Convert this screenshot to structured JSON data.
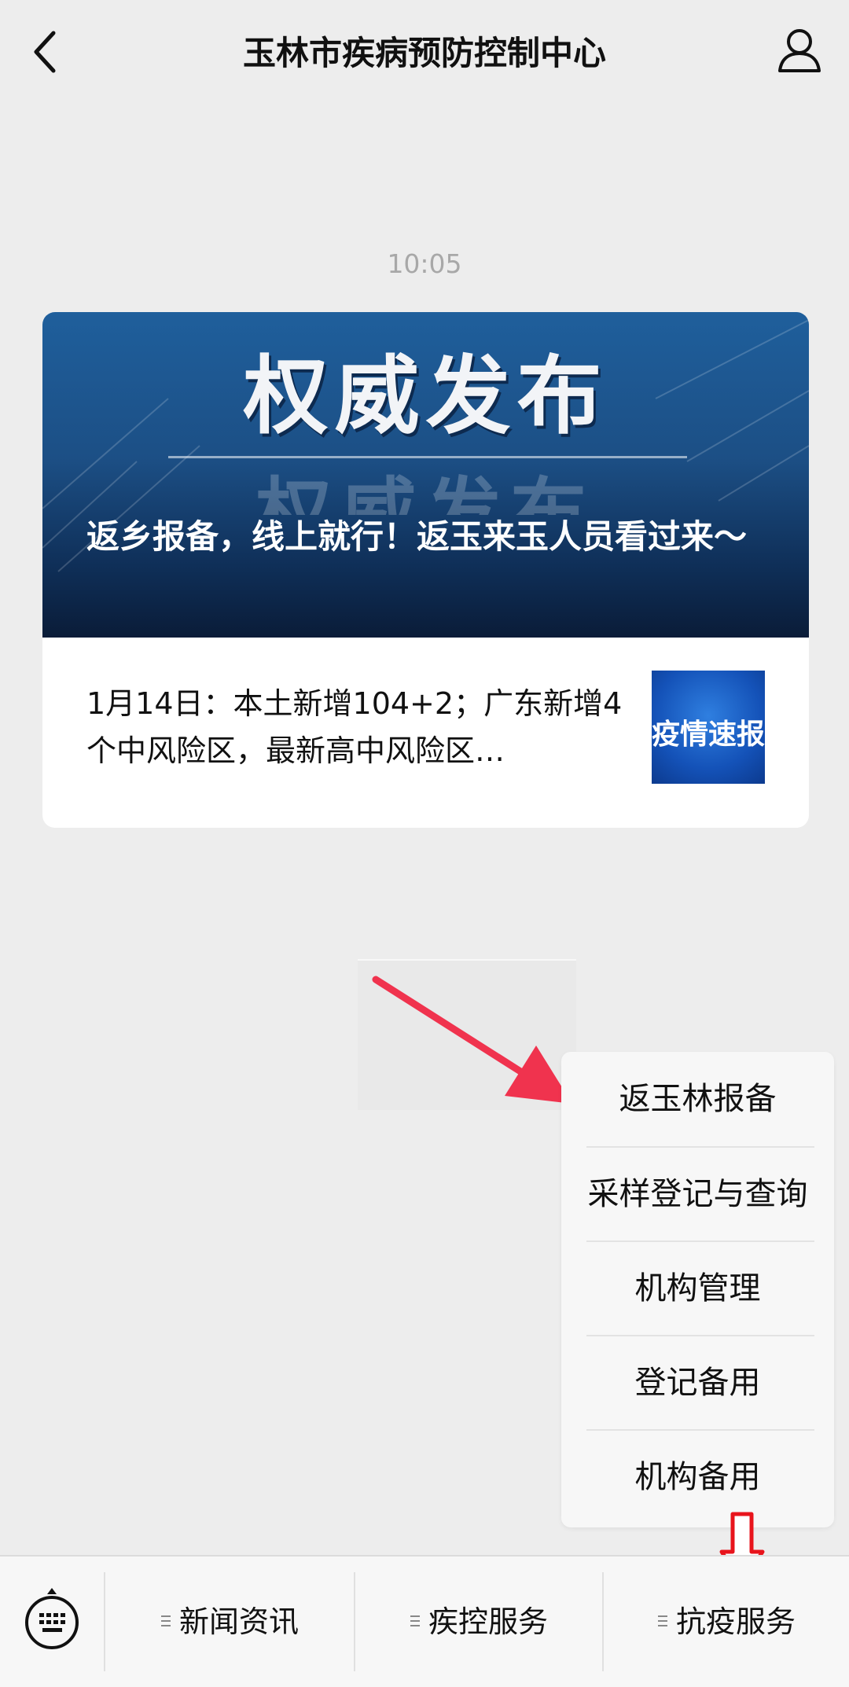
{
  "header": {
    "title": "玉林市疾病预防控制中心",
    "back_icon": "chevron-left-icon",
    "user_icon": "person-icon"
  },
  "chat": {
    "timestamp": "10:05",
    "card": {
      "banner_headline": "权威发布",
      "banner_ghost_text": "权威发布",
      "banner_caption": "返乡报备，线上就行！返玉来玉人员看过来～",
      "article_text": "1月14日：本土新增104+2；广东新增4个中风险区，最新高中风险区…",
      "thumbnail_text": "疫情速报"
    }
  },
  "menu": {
    "items": [
      {
        "label": "返玉林报备"
      },
      {
        "label": "采样登记与查询"
      },
      {
        "label": "机构管理"
      },
      {
        "label": "登记备用"
      },
      {
        "label": "机构备用"
      }
    ]
  },
  "bottom_bar": {
    "keyboard_icon": "keyboard-icon",
    "tabs": [
      {
        "label": "新闻资讯"
      },
      {
        "label": "疾控服务"
      },
      {
        "label": "抗疫服务"
      }
    ]
  },
  "colors": {
    "background": "#ededed",
    "annotation_arrow": "#f0334e",
    "annotation_down_arrow": "#e8141c",
    "banner_blue": "#1c4f85"
  }
}
